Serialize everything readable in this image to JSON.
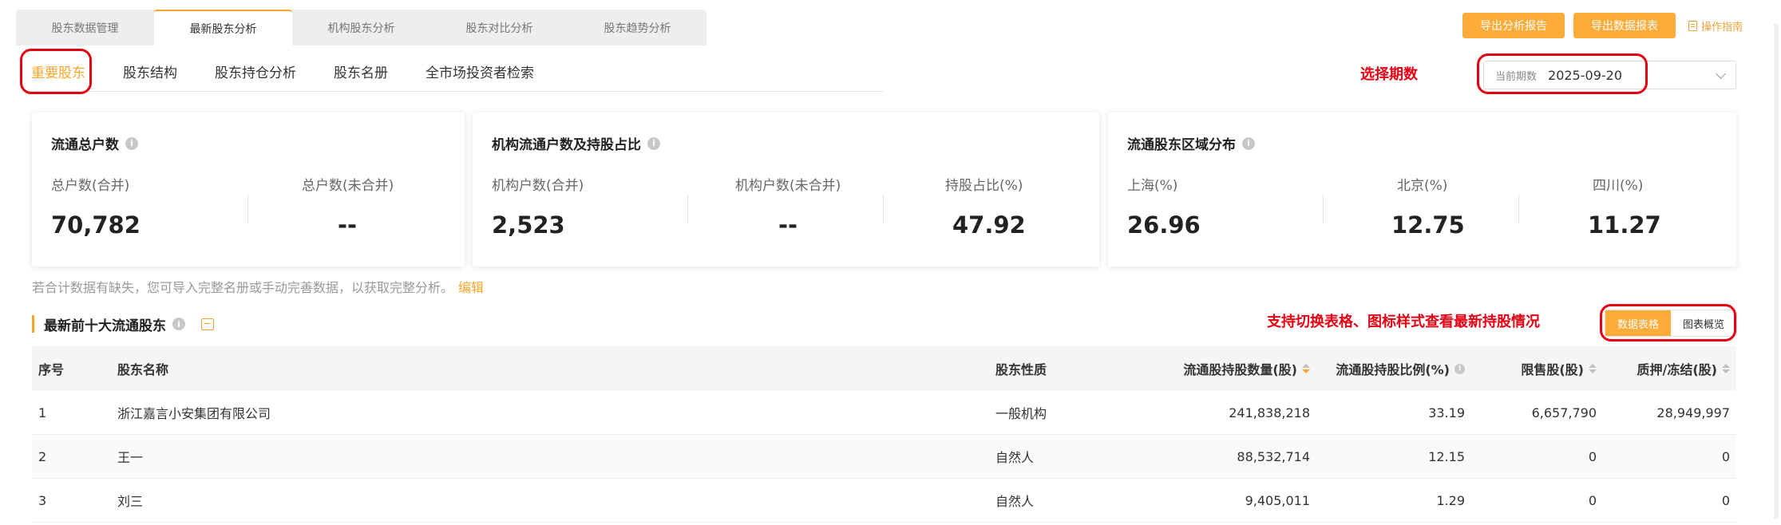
{
  "top_tabs": [
    {
      "label": "股东数据管理",
      "active": false
    },
    {
      "label": "最新股东分析",
      "active": true
    },
    {
      "label": "机构股东分析",
      "active": false
    },
    {
      "label": "股东对比分析",
      "active": false
    },
    {
      "label": "股东趋势分析",
      "active": false
    }
  ],
  "toolbar": {
    "export_report": "导出分析报告",
    "export_table": "导出数据报表",
    "guide": "操作指南"
  },
  "sub_tabs": [
    {
      "label": "重要股东",
      "active": true
    },
    {
      "label": "股东结构",
      "active": false
    },
    {
      "label": "股东持仓分析",
      "active": false
    },
    {
      "label": "股东名册",
      "active": false
    },
    {
      "label": "全市场投资者检索",
      "active": false
    }
  ],
  "annotations": {
    "select_period": "选择期数",
    "switch_view": "支持切换表格、图标样式查看最新持股情况"
  },
  "period": {
    "label": "当前期数",
    "value": "2025-09-20"
  },
  "cards": {
    "holders": {
      "title": "流通总户数",
      "metrics": [
        {
          "label": "总户数(合并)",
          "value": "70,782"
        },
        {
          "label": "总户数(未合并)",
          "value": "--"
        }
      ]
    },
    "institution": {
      "title": "机构流通户数及持股占比",
      "metrics": [
        {
          "label": "机构户数(合并)",
          "value": "2,523"
        },
        {
          "label": "机构户数(未合并)",
          "value": "--"
        },
        {
          "label": "持股占比(%)",
          "value": "47.92"
        }
      ]
    },
    "region": {
      "title": "流通股东区域分布",
      "metrics": [
        {
          "label": "上海(%)",
          "value": "26.96"
        },
        {
          "label": "北京(%)",
          "value": "12.75"
        },
        {
          "label": "四川(%)",
          "value": "11.27"
        }
      ]
    }
  },
  "note": {
    "text": "若合计数据有缺失，您可导入完整名册或手动完善数据，以获取完整分析。",
    "edit": "编辑"
  },
  "section": {
    "title": "最新前十大流通股东"
  },
  "view_toggle": {
    "table": "数据表格",
    "chart": "图表概览"
  },
  "table": {
    "headers": {
      "index": "序号",
      "name": "股东名称",
      "type": "股东性质",
      "shares": "流通股持股数量(股)",
      "ratio": "流通股持股比例(%)",
      "restricted": "限售股(股)",
      "pledged": "质押/冻结(股)"
    },
    "rows": [
      {
        "index": "1",
        "name": "浙江嘉言小安集团有限公司",
        "type": "一般机构",
        "shares": "241,838,218",
        "ratio": "33.19",
        "restricted": "6,657,790",
        "pledged": "28,949,997"
      },
      {
        "index": "2",
        "name": "王一",
        "type": "自然人",
        "shares": "88,532,714",
        "ratio": "12.15",
        "restricted": "0",
        "pledged": "0"
      },
      {
        "index": "3",
        "name": "刘三",
        "type": "自然人",
        "shares": "9,405,011",
        "ratio": "1.29",
        "restricted": "0",
        "pledged": "0"
      }
    ]
  }
}
